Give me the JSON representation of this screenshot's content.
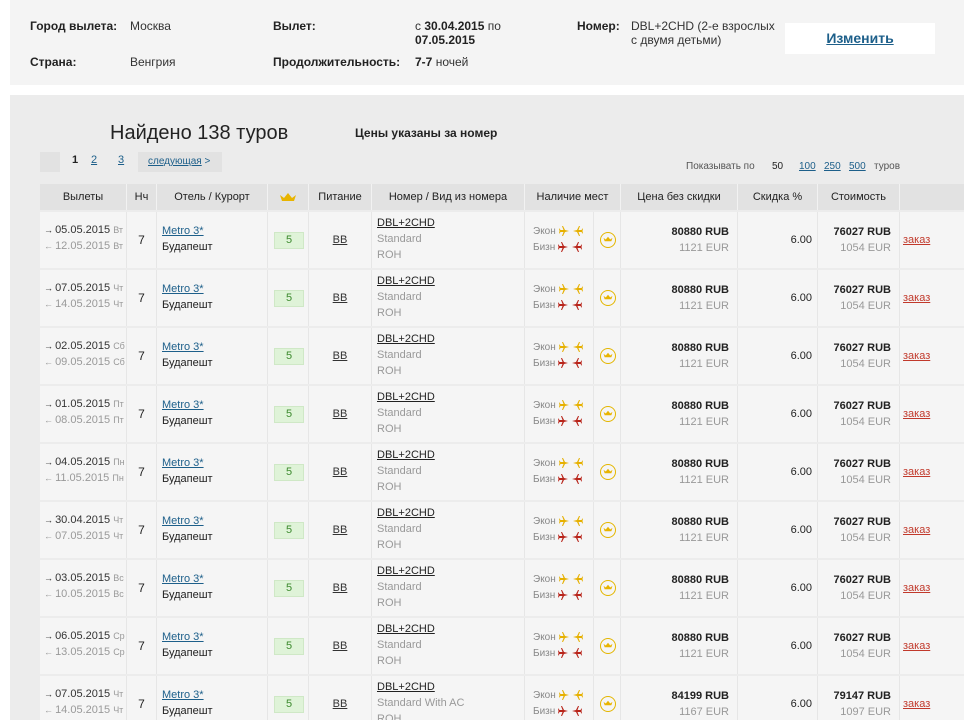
{
  "summary": {
    "city_label": "Город вылета:",
    "city_value": "Москва",
    "country_label": "Страна:",
    "country_value": "Венгрия",
    "departure_label": "Вылет:",
    "dep_prefix": "с",
    "dep_from": "30.04.2015",
    "dep_mid": "по",
    "dep_to": "07.05.2015",
    "duration_label": "Продолжительность:",
    "duration_bold": "7-7",
    "duration_unit": "ночей",
    "room_label": "Номер:",
    "room_value_line1": "DBL+2CHD (2-е взрослых",
    "room_value_line2": "с двумя детьми)",
    "change_label": "Изменить"
  },
  "results": {
    "title": "Найдено 138 туров",
    "price_note": "Цены указаны за номер",
    "pager": {
      "current": "1",
      "pages": [
        "2",
        "3"
      ],
      "next_label": "следующая",
      "next_arrow": ">"
    },
    "per_page": {
      "label": "Показывать по",
      "current": "50",
      "options": [
        "100",
        "250",
        "500"
      ],
      "suffix": "туров"
    }
  },
  "table": {
    "headers": {
      "departures": "Вылеты",
      "nights": "Нч",
      "hotel": "Отель / Курорт",
      "crown": "crown-icon",
      "meal": "Питание",
      "room": "Номер / Вид из номера",
      "availability": "Наличие мест",
      "price_no_discount": "Цена без скидки",
      "discount": "Скидка %",
      "cost": "Стоимость"
    },
    "econ_label": "Экон",
    "biz_label": "Бизн",
    "order_label": "заказ",
    "rows": [
      {
        "dep": "05.05.2015",
        "dep_dow": "Вт",
        "ret": "12.05.2015",
        "ret_dow": "Вт",
        "nights": "7",
        "hotel": "Metro 3*",
        "city": "Будапешт",
        "rating": "5",
        "meal": "BB",
        "room_code": "DBL+2CHD",
        "room_type": "Standard",
        "room_view": "ROH",
        "price_rub": "80880 RUB",
        "price_eur": "1121 EUR",
        "discount": "6.00",
        "cost_rub": "76027 RUB",
        "cost_eur": "1054 EUR"
      },
      {
        "dep": "07.05.2015",
        "dep_dow": "Чт",
        "ret": "14.05.2015",
        "ret_dow": "Чт",
        "nights": "7",
        "hotel": "Metro 3*",
        "city": "Будапешт",
        "rating": "5",
        "meal": "BB",
        "room_code": "DBL+2CHD",
        "room_type": "Standard",
        "room_view": "ROH",
        "price_rub": "80880 RUB",
        "price_eur": "1121 EUR",
        "discount": "6.00",
        "cost_rub": "76027 RUB",
        "cost_eur": "1054 EUR"
      },
      {
        "dep": "02.05.2015",
        "dep_dow": "Сб",
        "ret": "09.05.2015",
        "ret_dow": "Сб",
        "nights": "7",
        "hotel": "Metro 3*",
        "city": "Будапешт",
        "rating": "5",
        "meal": "BB",
        "room_code": "DBL+2CHD",
        "room_type": "Standard",
        "room_view": "ROH",
        "price_rub": "80880 RUB",
        "price_eur": "1121 EUR",
        "discount": "6.00",
        "cost_rub": "76027 RUB",
        "cost_eur": "1054 EUR"
      },
      {
        "dep": "01.05.2015",
        "dep_dow": "Пт",
        "ret": "08.05.2015",
        "ret_dow": "Пт",
        "nights": "7",
        "hotel": "Metro 3*",
        "city": "Будапешт",
        "rating": "5",
        "meal": "BB",
        "room_code": "DBL+2CHD",
        "room_type": "Standard",
        "room_view": "ROH",
        "price_rub": "80880 RUB",
        "price_eur": "1121 EUR",
        "discount": "6.00",
        "cost_rub": "76027 RUB",
        "cost_eur": "1054 EUR"
      },
      {
        "dep": "04.05.2015",
        "dep_dow": "Пн",
        "ret": "11.05.2015",
        "ret_dow": "Пн",
        "nights": "7",
        "hotel": "Metro 3*",
        "city": "Будапешт",
        "rating": "5",
        "meal": "BB",
        "room_code": "DBL+2CHD",
        "room_type": "Standard",
        "room_view": "ROH",
        "price_rub": "80880 RUB",
        "price_eur": "1121 EUR",
        "discount": "6.00",
        "cost_rub": "76027 RUB",
        "cost_eur": "1054 EUR"
      },
      {
        "dep": "30.04.2015",
        "dep_dow": "Чт",
        "ret": "07.05.2015",
        "ret_dow": "Чт",
        "nights": "7",
        "hotel": "Metro 3*",
        "city": "Будапешт",
        "rating": "5",
        "meal": "BB",
        "room_code": "DBL+2CHD",
        "room_type": "Standard",
        "room_view": "ROH",
        "price_rub": "80880 RUB",
        "price_eur": "1121 EUR",
        "discount": "6.00",
        "cost_rub": "76027 RUB",
        "cost_eur": "1054 EUR"
      },
      {
        "dep": "03.05.2015",
        "dep_dow": "Вс",
        "ret": "10.05.2015",
        "ret_dow": "Вс",
        "nights": "7",
        "hotel": "Metro 3*",
        "city": "Будапешт",
        "rating": "5",
        "meal": "BB",
        "room_code": "DBL+2CHD",
        "room_type": "Standard",
        "room_view": "ROH",
        "price_rub": "80880 RUB",
        "price_eur": "1121 EUR",
        "discount": "6.00",
        "cost_rub": "76027 RUB",
        "cost_eur": "1054 EUR"
      },
      {
        "dep": "06.05.2015",
        "dep_dow": "Ср",
        "ret": "13.05.2015",
        "ret_dow": "Ср",
        "nights": "7",
        "hotel": "Metro 3*",
        "city": "Будапешт",
        "rating": "5",
        "meal": "BB",
        "room_code": "DBL+2CHD",
        "room_type": "Standard",
        "room_view": "ROH",
        "price_rub": "80880 RUB",
        "price_eur": "1121 EUR",
        "discount": "6.00",
        "cost_rub": "76027 RUB",
        "cost_eur": "1054 EUR"
      },
      {
        "dep": "07.05.2015",
        "dep_dow": "Чт",
        "ret": "14.05.2015",
        "ret_dow": "Чт",
        "nights": "7",
        "hotel": "Metro 3*",
        "city": "Будапешт",
        "rating": "5",
        "meal": "BB",
        "room_code": "DBL+2CHD",
        "room_type": "Standard With AC",
        "room_view": "ROH",
        "price_rub": "84199 RUB",
        "price_eur": "1167 EUR",
        "discount": "6.00",
        "cost_rub": "79147 RUB",
        "cost_eur": "1097 EUR"
      }
    ]
  },
  "colors": {
    "link": "#1d5f8a",
    "order": "#c1392b",
    "crown": "#e8b400",
    "econ_plane": "#e6b000",
    "biz_plane": "#b8241a",
    "rating_bg": "#dff3d8"
  },
  "icons": {
    "departure_arrow": "→",
    "return_arrow": "←",
    "plane": "✈",
    "crown": "crown-icon",
    "circle_badge": "crown-circle-icon"
  }
}
